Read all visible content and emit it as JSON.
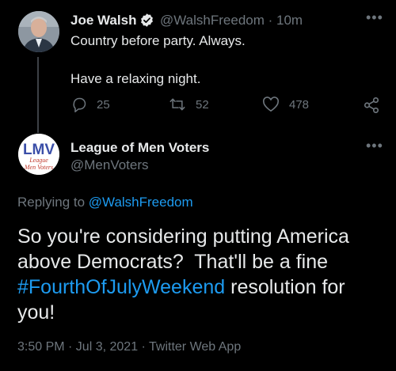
{
  "original_tweet": {
    "author_name": "Joe Walsh",
    "author_handle": "@WalshFreedom",
    "time_ago": "10m",
    "handle_time": "@WalshFreedom · 10m",
    "text_line1": "Country before party. Always.",
    "text_line2": "Have a relaxing night.",
    "replies": "25",
    "retweets": "52",
    "likes": "478"
  },
  "reply_tweet": {
    "author_name": "League of Men Voters",
    "author_handle": "@MenVoters",
    "avatar_logo_text": "LMV",
    "avatar_sub_line1": "League",
    "avatar_sub_line2": "Men Voters",
    "replying_prefix": "Replying to ",
    "replying_to": "@WalshFreedom",
    "text_before": "So you're considering putting America above Democrats?  That'll be a fine ",
    "hashtag": "#FourthOfJulyWeekend",
    "text_after": " resolution for you!",
    "timestamp": "3:50 PM · Jul 3, 2021 · Twitter Web App"
  },
  "icons": {
    "more": "more-icon",
    "verified": "verified-badge-icon",
    "reply": "reply-icon",
    "retweet": "retweet-icon",
    "like": "heart-icon",
    "share": "share-icon"
  },
  "colors": {
    "background": "#000000",
    "primary_text": "#e7e9ea",
    "secondary_text": "#6e767d",
    "link_blue": "#1d9bf0",
    "verified_badge": "#1d9bf0"
  },
  "more_glyph": "•••"
}
